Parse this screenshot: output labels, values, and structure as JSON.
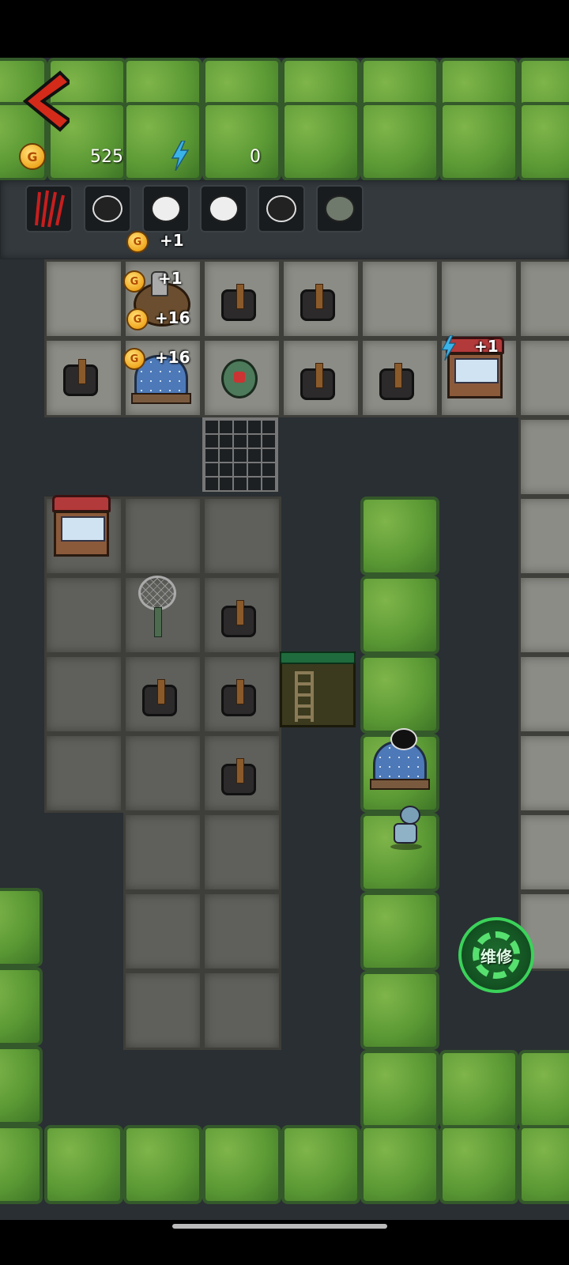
{
  "hud": {
    "gold_icon": "G",
    "gold_amount": "525",
    "energy_icon": "lightning-bolt-icon",
    "energy_amount": "0"
  },
  "roster": [
    "claw-slash-icon",
    "ghost-face-icon",
    "granny-face-icon",
    "granny-face-icon",
    "ghost-face-with-bow-icon",
    "green-granny-face-icon"
  ],
  "floating_income": [
    {
      "icon": "G",
      "text": "+1"
    },
    {
      "icon": "G",
      "text": "+1"
    },
    {
      "icon": "G",
      "text": "+16"
    },
    {
      "icon": "G",
      "text": "+16"
    },
    {
      "icon": "lightning-bolt-icon",
      "text": "+1"
    }
  ],
  "repair_button": {
    "label": "维修"
  },
  "colors": {
    "accent_green": "#3bd25a",
    "back_red": "#d42a1a",
    "energy_blue": "#3ab3e8",
    "coin_gold": "#f0a71f"
  }
}
